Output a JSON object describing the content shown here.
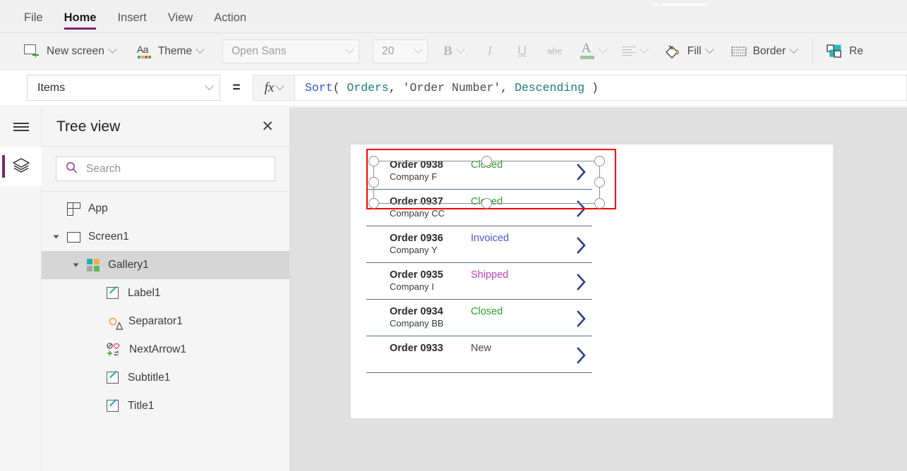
{
  "menu": {
    "items": [
      {
        "label": "File",
        "active": false
      },
      {
        "label": "Home",
        "active": true
      },
      {
        "label": "Insert",
        "active": false
      },
      {
        "label": "View",
        "active": false
      },
      {
        "label": "Action",
        "active": false
      }
    ]
  },
  "ribbon": {
    "new_screen": "New screen",
    "theme": "Theme",
    "font_family": "Open Sans",
    "font_size": "20",
    "bold": "B",
    "italic": "I",
    "underline": "U",
    "strikethrough": "abc",
    "fill": "Fill",
    "border": "Border",
    "reorder": "Re"
  },
  "formula_bar": {
    "property": "Items",
    "equals": "=",
    "fx": "fx",
    "formula_tokens": [
      {
        "text": "Sort",
        "type": "fn"
      },
      {
        "text": "( ",
        "type": "pn"
      },
      {
        "text": "Orders",
        "type": "id"
      },
      {
        "text": ", ",
        "type": "pn"
      },
      {
        "text": "'Order Number'",
        "type": "str"
      },
      {
        "text": ", ",
        "type": "pn"
      },
      {
        "text": "Descending",
        "type": "id"
      },
      {
        "text": " )",
        "type": "pn"
      }
    ]
  },
  "tree_panel": {
    "title": "Tree view",
    "close": "✕",
    "search_placeholder": "Search",
    "items": [
      {
        "label": "App",
        "icon": "app-icon",
        "indent": 0,
        "expander": false,
        "selected": false
      },
      {
        "label": "Screen1",
        "icon": "screen-icon",
        "indent": 0,
        "expander": true,
        "selected": false
      },
      {
        "label": "Gallery1",
        "icon": "gallery-icon",
        "indent": 1,
        "expander": true,
        "selected": true
      },
      {
        "label": "Label1",
        "icon": "label-icon",
        "indent": 2,
        "expander": false,
        "selected": false
      },
      {
        "label": "Separator1",
        "icon": "separator-icon",
        "indent": 2,
        "expander": false,
        "selected": false
      },
      {
        "label": "NextArrow1",
        "icon": "next-arrow-icon",
        "indent": 2,
        "expander": false,
        "selected": false
      },
      {
        "label": "Subtitle1",
        "icon": "label-icon",
        "indent": 2,
        "expander": false,
        "selected": false
      },
      {
        "label": "Title1",
        "icon": "label-icon",
        "indent": 2,
        "expander": false,
        "selected": false
      }
    ]
  },
  "canvas": {
    "gallery_rows": [
      {
        "title": "Order 0938",
        "subtitle": "Company F",
        "status": "Closed",
        "status_color": "#2f9e2f",
        "selected": true
      },
      {
        "title": "Order 0937",
        "subtitle": "Company CC",
        "status": "Closed",
        "status_color": "#2f9e2f",
        "selected": false
      },
      {
        "title": "Order 0936",
        "subtitle": "Company Y",
        "status": "Invoiced",
        "status_color": "#4a56d6",
        "selected": false
      },
      {
        "title": "Order 0935",
        "subtitle": "Company I",
        "status": "Shipped",
        "status_color": "#c43ec4",
        "selected": false
      },
      {
        "title": "Order 0934",
        "subtitle": "Company BB",
        "status": "Closed",
        "status_color": "#2f9e2f",
        "selected": false
      },
      {
        "title": "Order 0933",
        "subtitle": "",
        "status": "New",
        "status_color": "#4a4a4a",
        "selected": false
      }
    ]
  },
  "colors": {
    "accent_purple": "#742774",
    "selection_red": "#ff0000",
    "chevron_blue": "#2b3f8c",
    "row_divider": "#5b6b8c"
  }
}
